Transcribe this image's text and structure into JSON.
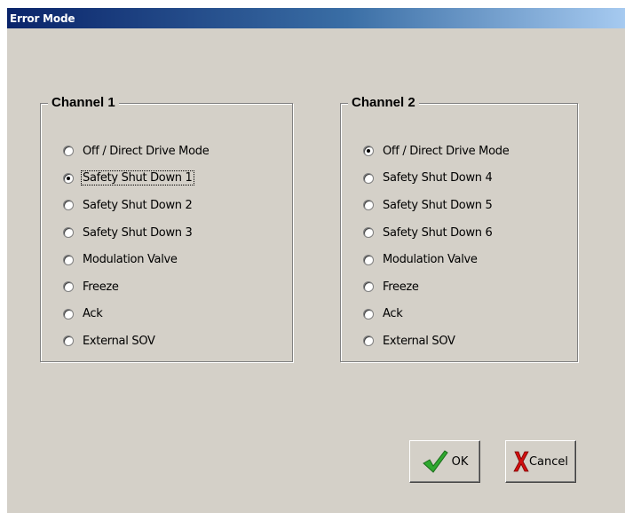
{
  "window": {
    "title": "Error Mode"
  },
  "channel1": {
    "title": "Channel 1",
    "options": [
      {
        "label": "Off / Direct Drive Mode",
        "checked": false
      },
      {
        "label": "Safety Shut Down 1",
        "checked": true
      },
      {
        "label": "Safety Shut Down 2",
        "checked": false
      },
      {
        "label": "Safety Shut Down 3",
        "checked": false
      },
      {
        "label": "Modulation Valve",
        "checked": false
      },
      {
        "label": "Freeze",
        "checked": false
      },
      {
        "label": "Ack",
        "checked": false
      },
      {
        "label": "External SOV",
        "checked": false
      }
    ]
  },
  "channel2": {
    "title": "Channel 2",
    "options": [
      {
        "label": "Off / Direct Drive Mode",
        "checked": true
      },
      {
        "label": "Safety Shut Down 4",
        "checked": false
      },
      {
        "label": "Safety Shut Down 5",
        "checked": false
      },
      {
        "label": "Safety Shut Down 6",
        "checked": false
      },
      {
        "label": "Modulation Valve",
        "checked": false
      },
      {
        "label": "Freeze",
        "checked": false
      },
      {
        "label": "Ack",
        "checked": false
      },
      {
        "label": "External SOV",
        "checked": false
      }
    ]
  },
  "buttons": {
    "ok_label": "OK",
    "cancel_label": "Cancel",
    "ok_icon": "checkmark-icon",
    "cancel_icon": "x-icon"
  },
  "colors": {
    "titlebar_start": "#0a246a",
    "titlebar_end": "#a6caf0",
    "dialog_bg": "#d4d0c8",
    "check_green": "#2fa82f",
    "cancel_red": "#d21010"
  }
}
